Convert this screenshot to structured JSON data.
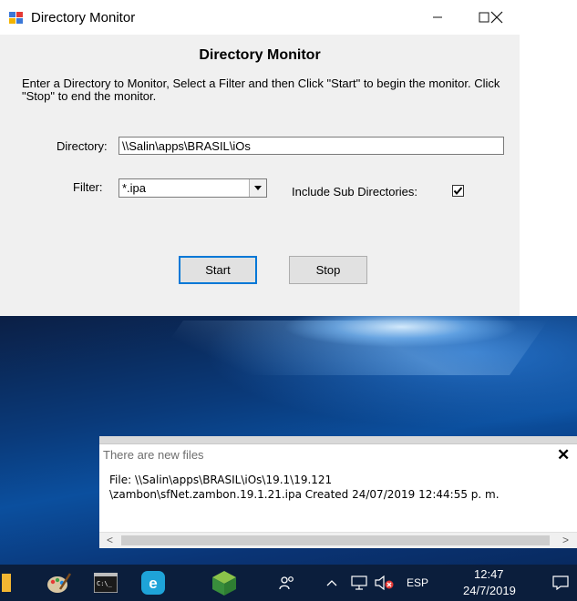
{
  "app_window": {
    "title": "Directory Monitor",
    "heading": "Directory Monitor",
    "description": "Enter a Directory to Monitor, Select a Filter and then Click \"Start\" to begin the monitor.  Click \"Stop\" to end the monitor.",
    "directory_label": "Directory:",
    "directory_value": "\\\\Salin\\apps\\BRASIL\\iOs",
    "filter_label": "Filter:",
    "filter_value": "*.ipa",
    "include_sub_label": "Include Sub Directories:",
    "include_sub_checked": true,
    "start_label": "Start",
    "stop_label": "Stop"
  },
  "notification": {
    "title": "There are new files",
    "line1": "File: \\\\Salin\\apps\\BRASIL\\iOs\\19.1\\19.121",
    "line2": "\\zambon\\sfNet.zambon.19.1.21.ipa Created 24/07/2019 12:44:55 p. m."
  },
  "taskbar": {
    "icons": [
      "folder-icon",
      "paint-icon",
      "terminal-icon",
      "browser-e-icon",
      "cube-icon"
    ],
    "tray": {
      "people_icon": "people-icon",
      "language": "ESP",
      "time": "12:47",
      "date": "24/7/2019"
    }
  },
  "colors": {
    "accent": "#0078d7",
    "taskbar": "#0b1e3c",
    "dialog_bg": "#f0f0f0"
  }
}
